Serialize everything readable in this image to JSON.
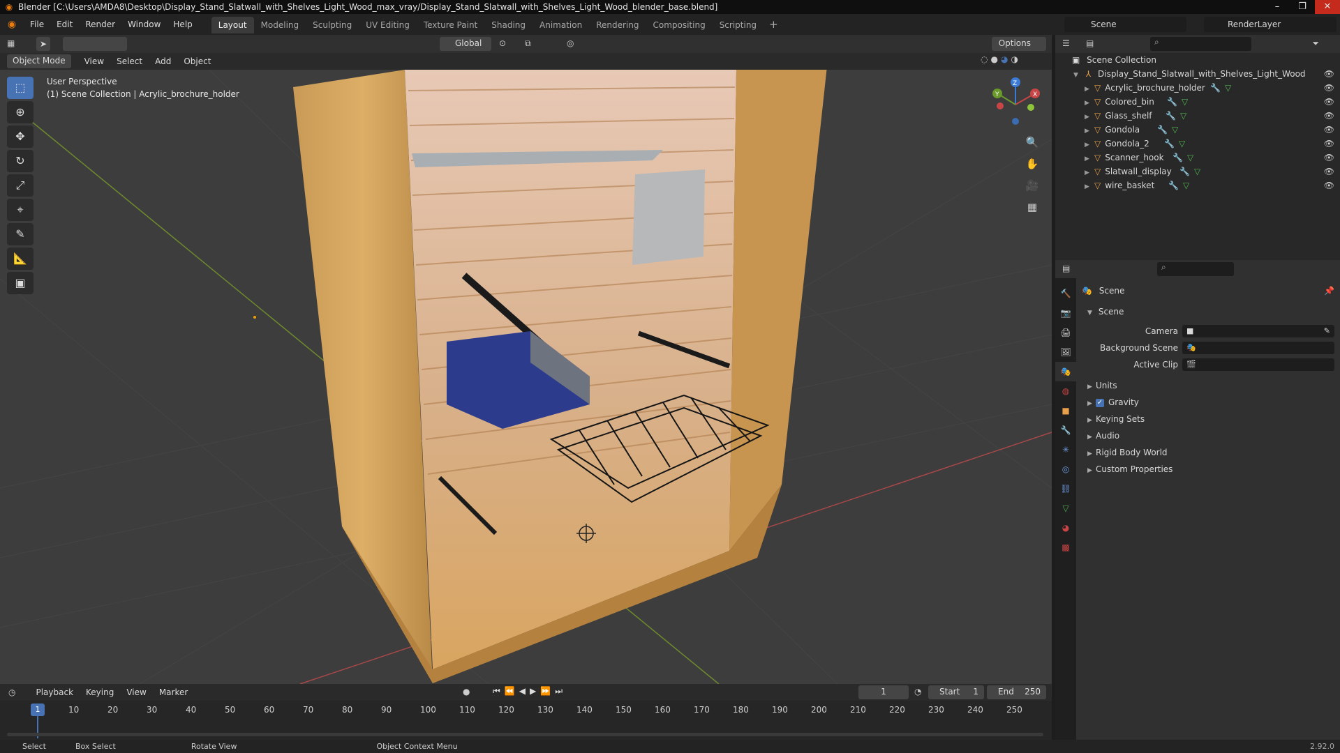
{
  "window": {
    "title": "Blender [C:\\Users\\AMDA8\\Desktop\\Display_Stand_Slatwall_with_Shelves_Light_Wood_max_vray/Display_Stand_Slatwall_with_Shelves_Light_Wood_blender_base.blend]",
    "minimize": "–",
    "maximize": "❐",
    "close": "✕"
  },
  "menus": [
    "File",
    "Edit",
    "Render",
    "Window",
    "Help"
  ],
  "workspaces": [
    "Layout",
    "Modeling",
    "Sculpting",
    "UV Editing",
    "Texture Paint",
    "Shading",
    "Animation",
    "Rendering",
    "Compositing",
    "Scripting"
  ],
  "workspace_add": "+",
  "scene_name": "Scene",
  "render_layer": "RenderLayer",
  "toolheader": {
    "orientation": "Global",
    "options": "Options"
  },
  "viewport_header": {
    "mode": "Object Mode",
    "menus": [
      "View",
      "Select",
      "Add",
      "Object"
    ]
  },
  "viewport": {
    "perspective": "User Perspective",
    "collection_info": "(1) Scene Collection | Acrylic_brochure_holder"
  },
  "gizmo": {
    "x": "X",
    "y": "Y",
    "z": "Z"
  },
  "timeline": {
    "menus": [
      "Playback",
      "Keying",
      "View",
      "Marker"
    ],
    "current_frame": "1",
    "start_label": "Start",
    "start": "1",
    "end_label": "End",
    "end": "250",
    "ticks": [
      "1",
      "10",
      "20",
      "30",
      "40",
      "50",
      "60",
      "70",
      "80",
      "90",
      "100",
      "110",
      "120",
      "130",
      "140",
      "150",
      "160",
      "170",
      "180",
      "190",
      "200",
      "210",
      "220",
      "230",
      "240",
      "250"
    ]
  },
  "statusbar": {
    "select": "Select",
    "box_select": "Box Select",
    "rotate_view": "Rotate View",
    "context_menu": "Object Context Menu",
    "version": "2.92.0"
  },
  "outliner": {
    "root": "Scene Collection",
    "collection": "Display_Stand_Slatwall_with_Shelves_Light_Wood",
    "objects": [
      "Acrylic_brochure_holder",
      "Colored_bin",
      "Glass_shelf",
      "Gondola",
      "Gondola_2",
      "Scanner_hook",
      "Slatwall_display",
      "wire_basket"
    ]
  },
  "properties": {
    "context": "Scene",
    "panel": "Scene",
    "camera_label": "Camera",
    "background_label": "Background Scene",
    "clip_label": "Active Clip",
    "sections": [
      "Units",
      "Gravity",
      "Keying Sets",
      "Audio",
      "Rigid Body World",
      "Custom Properties"
    ]
  },
  "colors": {
    "accent": "#4772b3",
    "blender_orange": "#e87d0d",
    "viewport_bg": "#3d3d3d"
  }
}
